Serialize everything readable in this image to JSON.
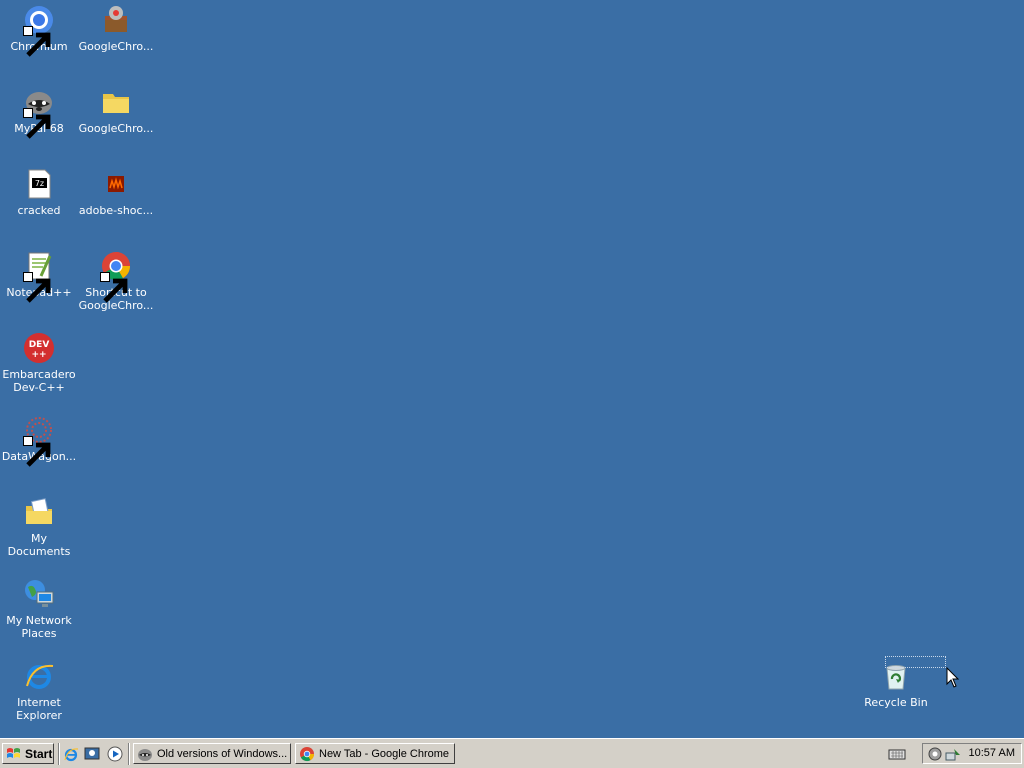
{
  "desktop": {
    "background": "#3a6ea5",
    "icons": [
      {
        "label": "Chromium",
        "icon": "chromium-icon"
      },
      {
        "label": "GoogleChro...",
        "icon": "installer-package-icon"
      },
      {
        "label": "MyPal 68",
        "icon": "raccoon-icon"
      },
      {
        "label": "GoogleChro...",
        "icon": "folder-icon"
      },
      {
        "label": "cracked",
        "icon": "7z-archive-icon"
      },
      {
        "label": "adobe-shoc...",
        "icon": "shockwave-icon"
      },
      {
        "label": "Notepad++",
        "icon": "notepadpp-icon"
      },
      {
        "label": "Shortcut to GoogleChro...",
        "icon": "chrome-icon"
      },
      {
        "label": "Embarcadero Dev-C++",
        "icon": "devcpp-icon"
      },
      {
        "label": "DataWagon...",
        "icon": "datawagon-icon"
      },
      {
        "label": "My Documents",
        "icon": "my-documents-icon"
      },
      {
        "label": "My Network Places",
        "icon": "network-places-icon"
      },
      {
        "label": "Internet Explorer",
        "icon": "internet-explorer-icon"
      },
      {
        "label": "Recycle Bin",
        "icon": "recycle-bin-icon"
      }
    ]
  },
  "taskbar": {
    "start_label": "Start",
    "tasks": [
      {
        "label": "Old versions of Windows...",
        "icon": "raccoon-icon"
      },
      {
        "label": "New Tab - Google Chrome",
        "icon": "chrome-icon"
      }
    ],
    "clock": "10:57 AM"
  }
}
